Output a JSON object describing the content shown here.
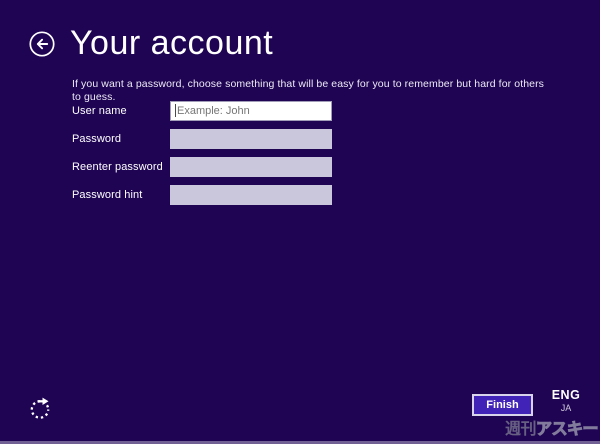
{
  "colors": {
    "background": "#1f0454",
    "accent": "#4123b8",
    "field_disabled": "#cac6dc",
    "field_enabled": "#ffffff"
  },
  "header": {
    "title": "Your account"
  },
  "intro": {
    "text": "If you want a password, choose something that will be easy for you to remember but hard for others to guess."
  },
  "form": {
    "rows": [
      {
        "label": "User name",
        "placeholder": "Example: John",
        "value": ""
      },
      {
        "label": "Password",
        "placeholder": "",
        "value": ""
      },
      {
        "label": "Reenter password",
        "placeholder": "",
        "value": ""
      },
      {
        "label": "Password hint",
        "placeholder": "",
        "value": ""
      }
    ]
  },
  "footer": {
    "finish_button": "Finish",
    "language_primary": "ENG",
    "language_secondary": "JA"
  },
  "icons": {
    "back": "back-arrow-icon",
    "ease_of_access": "ease-of-access-icon"
  },
  "watermark": {
    "text": "週刊アスキー",
    "part_filled": "週刊",
    "part_outline": "アスキー"
  }
}
